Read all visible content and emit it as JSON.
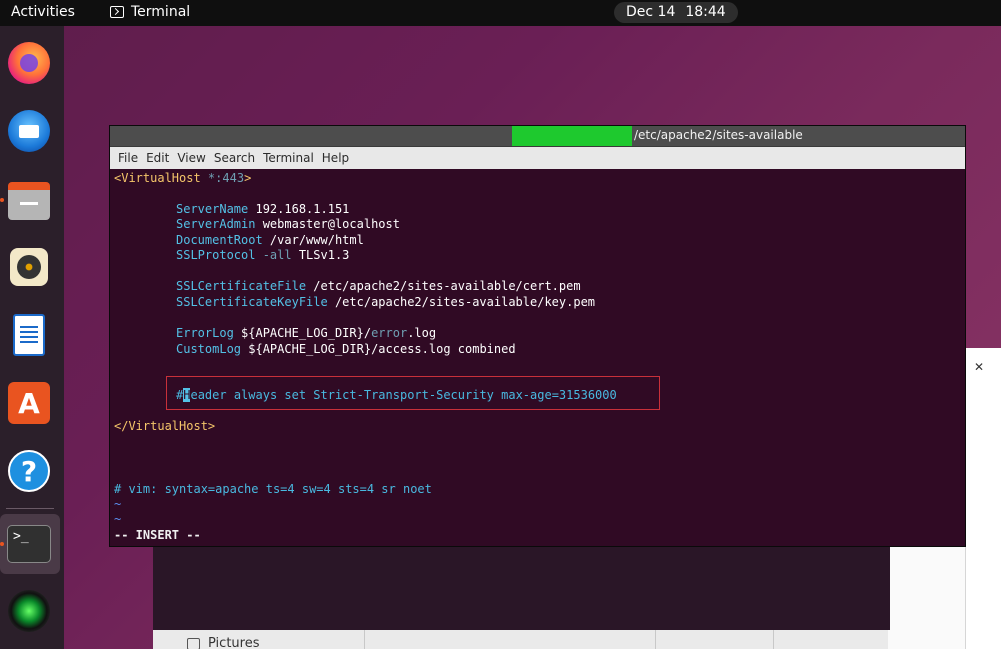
{
  "topbar": {
    "activities": "Activities",
    "app_name": "Terminal",
    "date": "Dec 14",
    "time": "18:44"
  },
  "dock": {
    "items": [
      "firefox-icon",
      "thunderbird-icon",
      "files-icon",
      "rhythmbox-icon",
      "writer-icon",
      "app-center-icon",
      "help-icon",
      "terminal-icon",
      "cheese-icon"
    ],
    "store_glyph": "A",
    "help_glyph": "?",
    "terminal_glyph": ">_"
  },
  "file_manager": {
    "sidebar_item": "Pictures"
  },
  "terminal": {
    "title_path": "/etc/apache2/sites-available",
    "menu": [
      "File",
      "Edit",
      "View",
      "Search",
      "Terminal",
      "Help"
    ],
    "lines": {
      "vh_open_tag": "<VirtualHost",
      "vh_open_faded": " *:443",
      "vh_open_end": ">",
      "server_name_kw": "ServerName",
      "server_name_val": " 192.168.1.151",
      "server_admin_kw": "ServerAdmin",
      "server_admin_val": " webmaster@localhost",
      "doc_root_kw": "DocumentRoot",
      "doc_root_val": " /var/www/html",
      "ssl_proto_kw": "SSLProtocol",
      "ssl_proto_faded": " -all",
      "ssl_proto_val": " TLSv1.3",
      "cert_kw": "SSLCertificateFile",
      "cert_val": " /etc/apache2/sites-available/cert.pem",
      "key_kw": "SSLCertificateKeyFile",
      "key_val": " /etc/apache2/sites-available/key.pem",
      "errorlog_kw": "ErrorLog",
      "errorlog_val1": " ${APACHE_LOG_DIR}/",
      "errorlog_faded": "error",
      "errorlog_val2": ".log",
      "customlog_kw": "CustomLog",
      "customlog_val": " ${APACHE_LOG_DIR}/access.log combined",
      "header_hash": "#",
      "header_cursor": "H",
      "header_rest": "eader always set Strict-Transport-Security max-age=31536000",
      "vh_close": "</VirtualHost>",
      "modeline": "# vim: syntax=apache ts=4 sw=4 sts=4 sr noet",
      "tilde1": "~",
      "tilde2": "~",
      "mode": "-- INSERT --"
    }
  }
}
